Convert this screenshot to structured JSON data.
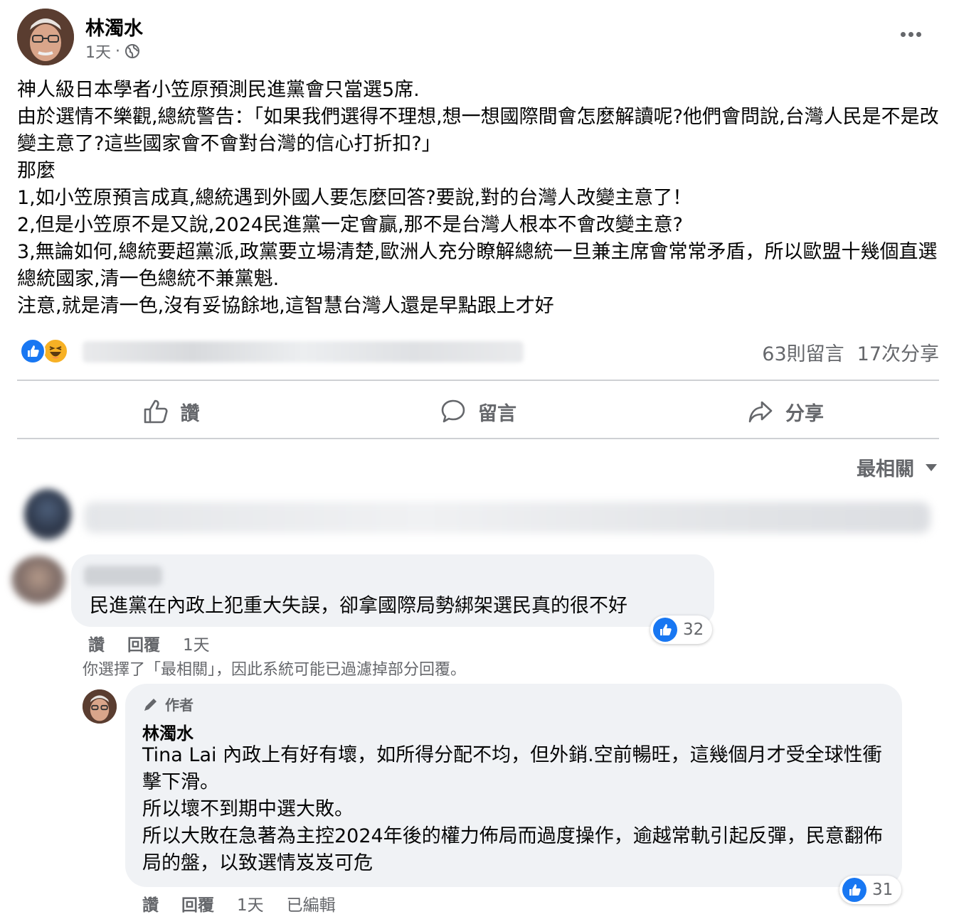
{
  "post": {
    "author": "林濁水",
    "time": "1天",
    "privacy_icon": "globe-icon",
    "lines": [
      "神人級日本學者小笠原預測民進黨會只當選5席.",
      "由於選情不樂觀,總統警告：「如果我們選得不理想,想一想國際間會怎麼解讀呢?他們會問說,台灣人民是不是改變主意了?這些國家會不會對台灣的信心打折扣?」",
      "那麼",
      "1,如小笠原預言成真,總統遇到外國人要怎麼回答?要說,對的台灣人改變主意了！",
      "2,但是小笠原不是又說,2024民進黨一定會贏,那不是台灣人根本不會改變主意?",
      "3,無論如何,總統要超黨派,政黨要立場清楚,歐洲人充分瞭解總統一旦兼主席會常常矛盾，所以歐盟十幾個直選總統國家,清一色總統不兼黨魁.",
      "注意,就是清一色,沒有妥協餘地,這智慧台灣人還是早點跟上才好"
    ],
    "comments_count": "63則留言",
    "shares_count": "17次分享"
  },
  "actions": {
    "like": "讚",
    "comment": "留言",
    "share": "分享"
  },
  "sort": {
    "label": "最相關"
  },
  "comment1": {
    "text": "民進黨在內政上犯重大失誤，卻拿國際局勢綁架選民真的很不好",
    "likes": "32",
    "like_label": "讚",
    "reply_label": "回覆",
    "time": "1天"
  },
  "filter_note": "你選擇了「最相關」，因此系統可能已過濾掉部分回覆。",
  "reply": {
    "badge": "作者",
    "author": "林濁水",
    "lines": [
      "Tina Lai 內政上有好有壞，如所得分配不均，但外銷.空前暢旺，這幾個月才受全球性衝擊下滑。",
      "所以壞不到期中選大敗。",
      "所以大敗在急著為主控2024年後的權力佈局而過度操作，逾越常軌引起反彈，民意翻佈局的盤，以致選情岌岌可危"
    ],
    "likes": "31",
    "like_label": "讚",
    "reply_label": "回覆",
    "time": "1天",
    "edited": "已編輯"
  },
  "colors": {
    "brand_blue": "#1877f2",
    "secondary_text": "#65676b",
    "bubble_bg": "#f0f2f5"
  }
}
